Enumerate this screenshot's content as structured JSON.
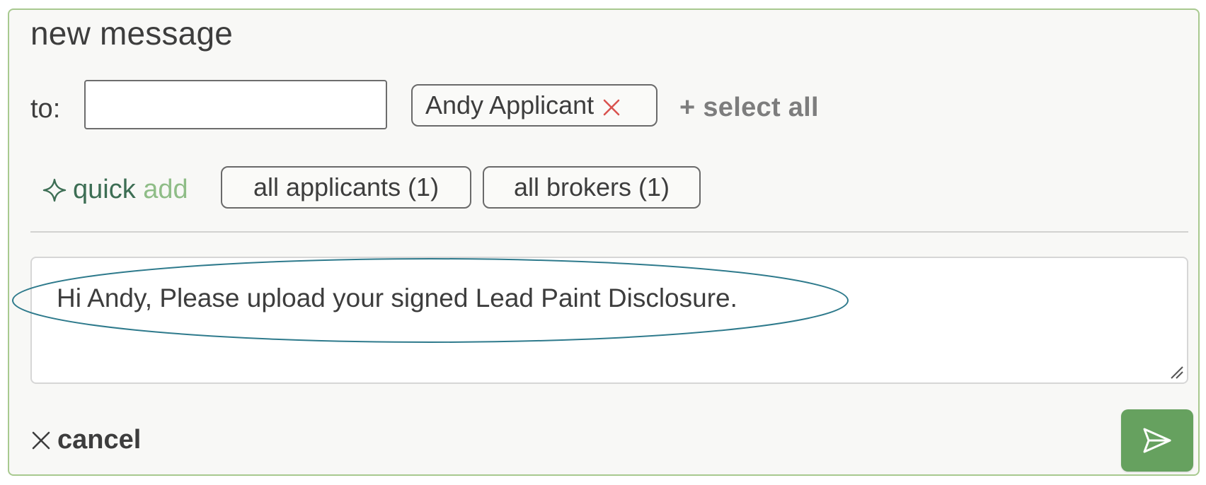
{
  "title": "new message",
  "to": {
    "label": "to:",
    "input_value": "",
    "recipients": [
      {
        "name": "Andy Applicant",
        "remove_icon": "close-icon",
        "remove_color": "#d9534f"
      }
    ],
    "select_all_label": "+ select all"
  },
  "quick_add": {
    "icon": "sparkle-icon",
    "label_word1": "quick",
    "label_word2": "add",
    "groups": [
      {
        "label": "all applicants (1)"
      },
      {
        "label": "all brokers (1)"
      }
    ]
  },
  "message": {
    "text": "Hi Andy, Please upload your signed Lead Paint Disclosure."
  },
  "footer": {
    "cancel_icon": "close-icon",
    "cancel_label": "cancel",
    "send_icon": "send-icon"
  },
  "colors": {
    "accent": "#66a15f",
    "border": "#a8c98f",
    "quick_primary": "#3d6e54",
    "quick_secondary": "#8fbd87",
    "highlight": "#2e7a8c"
  }
}
